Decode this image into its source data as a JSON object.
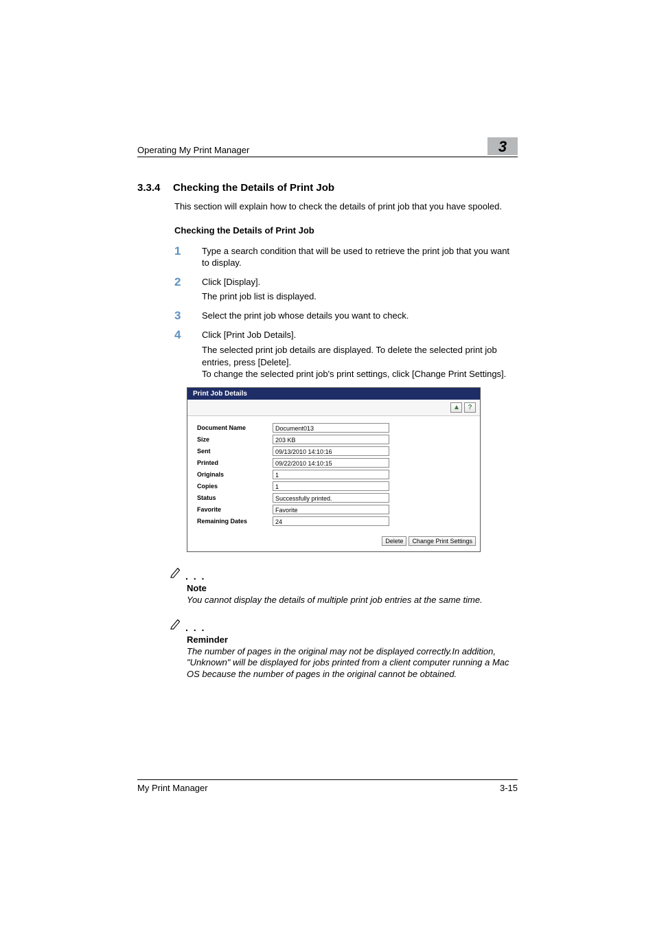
{
  "header": {
    "running_title": "Operating My Print Manager",
    "chapter_number": "3"
  },
  "section": {
    "number": "3.3.4",
    "title": "Checking the Details of Print Job",
    "intro": "This section will explain how to check the details of print job that you have spooled.",
    "sub_heading": "Checking the Details of Print Job"
  },
  "steps": [
    {
      "num": "1",
      "body": "Type a search condition that will be used to retrieve the print job that you want to display."
    },
    {
      "num": "2",
      "body": "Click [Display].",
      "extra": "The print job list is displayed."
    },
    {
      "num": "3",
      "body": "Select the print job whose details you want to check."
    },
    {
      "num": "4",
      "body": "Click [Print Job Details].",
      "extra": "The selected print job details are displayed. To delete the selected print job entries, press [Delete].\nTo change the selected print job's print settings, click [Change Print Settings]."
    }
  ],
  "panel": {
    "title": "Print Job Details",
    "fields": [
      {
        "label": "Document Name",
        "value": "Document013"
      },
      {
        "label": "Size",
        "value": "203 KB"
      },
      {
        "label": "Sent",
        "value": "09/13/2010 14:10:16"
      },
      {
        "label": "Printed",
        "value": "09/22/2010 14:10:15"
      },
      {
        "label": "Originals",
        "value": "1"
      },
      {
        "label": "Copies",
        "value": "1"
      },
      {
        "label": "Status",
        "value": "Successfully printed."
      },
      {
        "label": "Favorite",
        "value": "Favorite"
      },
      {
        "label": "Remaining Dates",
        "value": "24"
      }
    ],
    "buttons": {
      "delete": "Delete",
      "change": "Change Print Settings"
    }
  },
  "notes": [
    {
      "title": "Note",
      "text": "You cannot display the details of multiple print job entries at the same time."
    },
    {
      "title": "Reminder",
      "text": "The number of pages in the original may not be displayed correctly.In addition, \"Unknown\" will be displayed for jobs printed from a client computer running a Mac OS because the number of pages in the original cannot be obtained."
    }
  ],
  "footer": {
    "left": "My Print Manager",
    "right": "3-15"
  }
}
